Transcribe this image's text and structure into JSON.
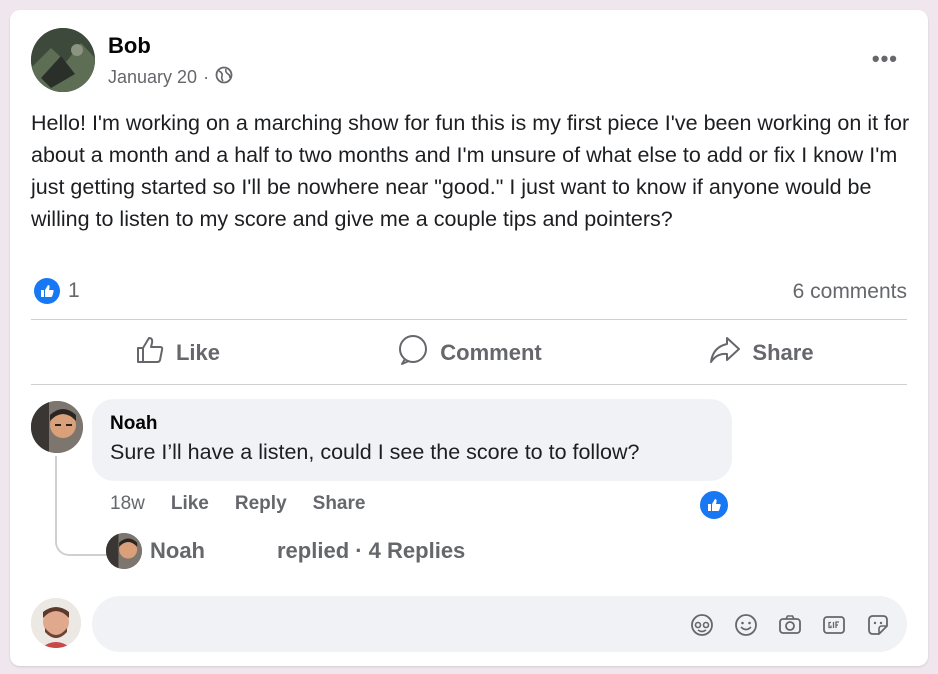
{
  "post": {
    "author": "Bob",
    "date": "January 20",
    "dot": "·",
    "privacy_icon": "globe-icon",
    "more_label": "•••",
    "text": "Hello! I'm working on a marching show for fun this is my first piece I've been working on it for about a month and a half to two months and I'm unsure of what else to add or fix I know I'm just getting started so I'll be nowhere near \"good.\" I just want to know if anyone would be willing to listen to my score and give me a couple tips and pointers?",
    "reaction_count": "1",
    "comments_count": "6 comments"
  },
  "actions": {
    "like": "Like",
    "comment": "Comment",
    "share": "Share"
  },
  "comment": {
    "author": "Noah",
    "text": "Sure I’ll have a listen, could I see the score to to follow?",
    "time": "18w",
    "like": "Like",
    "reply": "Reply",
    "share": "Share"
  },
  "replies": {
    "author": "Noah",
    "text": "replied · 4 Replies"
  },
  "composer": {
    "icons": [
      "avatar-sticker-icon",
      "emoji-icon",
      "camera-icon",
      "gif-icon",
      "sticker-icon"
    ]
  },
  "colors": {
    "accent": "#1877f2",
    "secondary_text": "#65676b",
    "bubble_bg": "#f0f2f5",
    "page_bg": "#f0e6ee"
  }
}
